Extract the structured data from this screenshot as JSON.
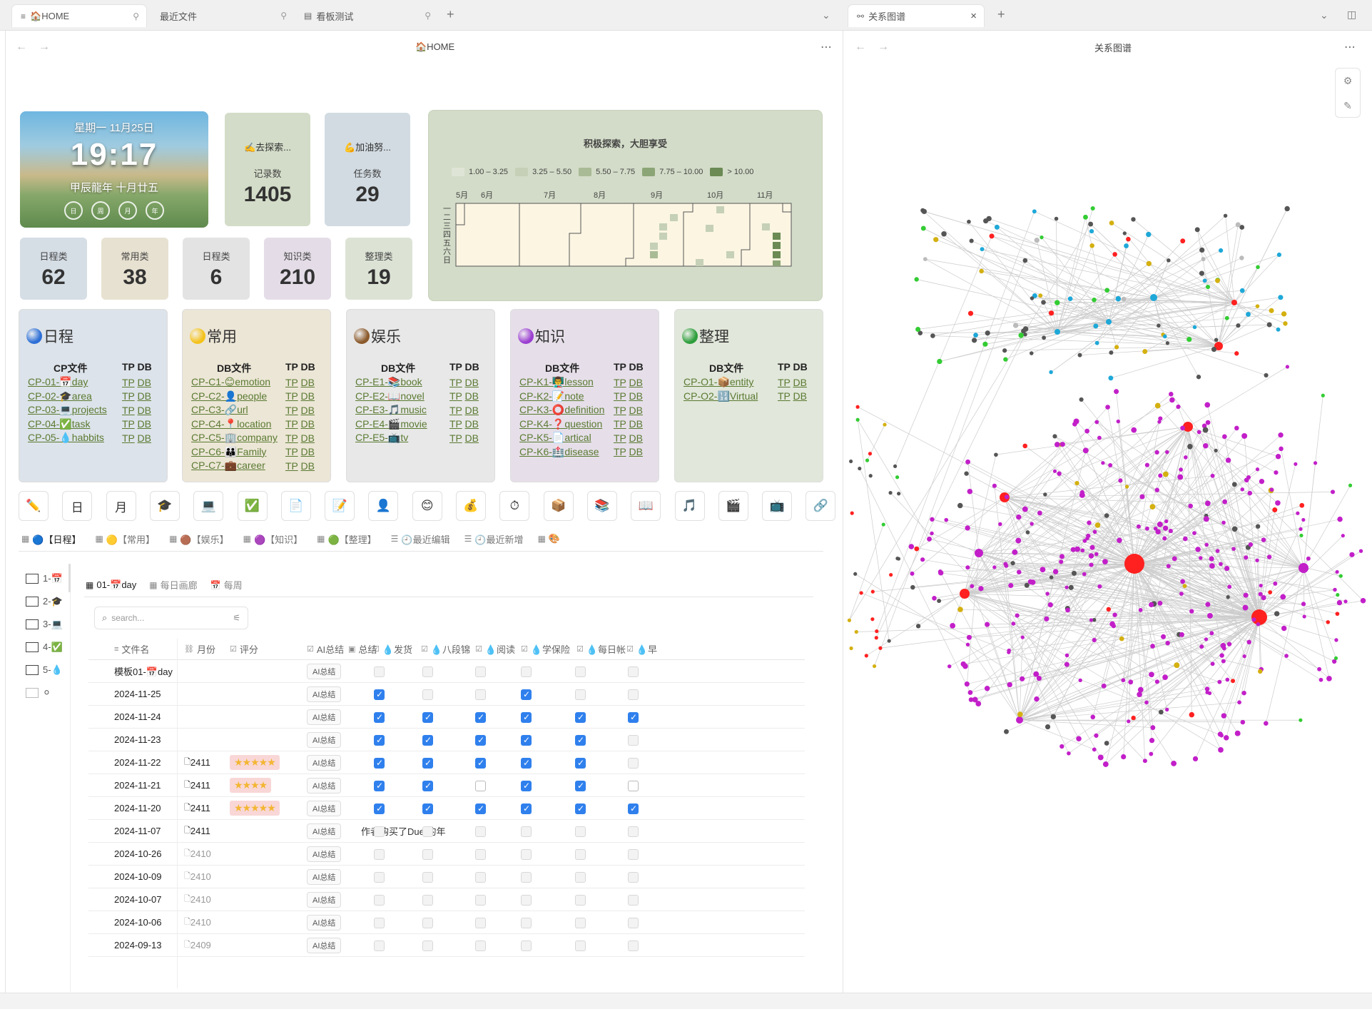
{
  "tabs": [
    {
      "label": "🏠HOME",
      "icon": "≡",
      "pin": "⚲"
    },
    {
      "label": "最近文件",
      "pin": "⚲"
    },
    {
      "label": "看板测试",
      "icon": "▤",
      "pin": "⚲"
    }
  ],
  "right_tab": {
    "label": "关系图谱",
    "icon": "⚯"
  },
  "left_pane_title": "🏠HOME",
  "right_pane_title": "关系图谱",
  "clock": {
    "date": "星期一 11月25日",
    "time": "19:17",
    "lunar": "甲辰龍年 十月廿五",
    "rings": [
      "日",
      "周",
      "月",
      "年"
    ]
  },
  "stat_cards": [
    {
      "title": "✍️去探索...",
      "label": "记录数",
      "value": "1405",
      "bg": "#d3dcc8"
    },
    {
      "title": "💪加油努...",
      "label": "任务数",
      "value": "29",
      "bg": "#d2dbe2"
    },
    {
      "label": "日程类",
      "value": "62",
      "bg": "#d5dde5"
    },
    {
      "label": "常用类",
      "value": "38",
      "bg": "#e7e1d1"
    },
    {
      "label": "日程类",
      "value": "6",
      "bg": "#e3e3e3"
    },
    {
      "label": "知识类",
      "value": "210",
      "bg": "#e4dde8"
    },
    {
      "label": "整理类",
      "value": "19",
      "bg": "#dce3d5"
    }
  ],
  "heatmap": {
    "title": "积极探索，大胆享受",
    "legend": [
      "1.00 – 3.25",
      "3.25 – 5.50",
      "5.50 – 7.75",
      "7.75 – 10.00",
      "> 10.00"
    ],
    "legend_colors": [
      "#dfe5d6",
      "#c5d0b7",
      "#a9bb95",
      "#8ca576",
      "#6b8a54"
    ],
    "months": [
      "5月",
      "6月",
      "7月",
      "8月",
      "9月",
      "10月",
      "11月"
    ],
    "weekdays": [
      "一",
      "二",
      "三",
      "四",
      "五",
      "六",
      "日"
    ]
  },
  "categories": [
    {
      "title": "日程",
      "dot": "#2d6fd6",
      "bg": "#dde3ea",
      "head": "CP文件",
      "rows": [
        [
          "CP-01-📅day"
        ],
        [
          "CP-02-🎓area"
        ],
        [
          "CP-03-💻projects"
        ],
        [
          "CP-04-✅task"
        ],
        [
          "CP-05-💧habbits"
        ]
      ]
    },
    {
      "title": "常用",
      "dot": "#f4c21b",
      "bg": "#ece6d6",
      "head": "DB文件",
      "rows": [
        [
          "CP-C1-😊emotion"
        ],
        [
          "CP-C2-👤people"
        ],
        [
          "CP-C3-🔗url"
        ],
        [
          "CP-C4-📍location"
        ],
        [
          "CP-C5-🏢company"
        ],
        [
          "CP-C6-👪Family"
        ],
        [
          "CP-C7-💼career"
        ]
      ]
    },
    {
      "title": "娱乐",
      "dot": "#8b5a2b",
      "bg": "#e8e8e8",
      "head": "DB文件",
      "rows": [
        [
          "CP-E1-📚book"
        ],
        [
          "CP-E2-📖novel"
        ],
        [
          "CP-E3-🎵music"
        ],
        [
          "CP-E4-🎬movie"
        ],
        [
          "CP-E5-📺tv"
        ]
      ]
    },
    {
      "title": "知识",
      "dot": "#9b3fd1",
      "bg": "#e6dfe9",
      "head": "DB文件",
      "rows": [
        [
          "CP-K1-👨‍🏫lesson"
        ],
        [
          "CP-K2-📝note"
        ],
        [
          "CP-K3-⭕definition"
        ],
        [
          "CP-K4-❓question"
        ],
        [
          "CP-K5-📄artical"
        ],
        [
          "CP-K6-🏥disease"
        ]
      ]
    },
    {
      "title": "整理",
      "dot": "#2e9e3c",
      "bg": "#e1e7da",
      "head": "DB文件",
      "rows": [
        [
          "CP-O1-📦entity"
        ],
        [
          "CP-O2-🔢Virtual"
        ]
      ]
    }
  ],
  "tp": "TP",
  "db": "DB",
  "tpdb_head": "TP DB",
  "icon_row": [
    "✏️",
    "日",
    "月",
    "🎓",
    "💻",
    "✅",
    "📄",
    "📝",
    "👤",
    "😊",
    "💰",
    "⏱",
    "📦",
    "📚",
    "📖",
    "🎵",
    "🎬",
    "📺",
    "🔗"
  ],
  "view_tabs": [
    {
      "label": "🔵【日程】",
      "active": true
    },
    {
      "label": "🟡【常用】"
    },
    {
      "label": "🟤【娱乐】"
    },
    {
      "label": "🟣【知识】"
    },
    {
      "label": "🟢【整理】"
    },
    {
      "label": "🕘最近编辑",
      "list": true
    },
    {
      "label": "🕘最近新增",
      "list": true
    },
    {
      "label": "🎨",
      "grid": true
    }
  ],
  "side_items": [
    "1-📅",
    "2-🎓",
    "3-💻",
    "4-✅",
    "5-💧",
    "⚪"
  ],
  "sub_tabs": [
    {
      "label": "01-📅day",
      "active": true,
      "icon": "▦"
    },
    {
      "label": "每日画廊",
      "icon": "▦"
    },
    {
      "label": "每周",
      "icon": "📅"
    }
  ],
  "search": {
    "placeholder": "search..."
  },
  "columns": {
    "name": "文件名",
    "month": "月份",
    "rating": "评分",
    "ai": "AI总结",
    "summary": "总结",
    "habits": [
      "💧发货",
      "💧八段锦",
      "💧阅读",
      "💧学保险",
      "💧每日帐",
      "💧早"
    ]
  },
  "ai_label": "AI总结",
  "rows": [
    {
      "name": "模板01-📅day",
      "month": "",
      "stars": 0,
      "summary": "",
      "checks": [
        0,
        0,
        0,
        0,
        0,
        0
      ]
    },
    {
      "name": "2024-11-25",
      "month": "",
      "stars": 0,
      "summary": "",
      "checks": [
        1,
        0,
        0,
        1,
        0,
        0
      ]
    },
    {
      "name": "2024-11-24",
      "month": "",
      "stars": 0,
      "summary": "",
      "checks": [
        1,
        1,
        1,
        1,
        1,
        1
      ]
    },
    {
      "name": "2024-11-23",
      "month": "",
      "stars": 0,
      "summary": "",
      "checks": [
        1,
        1,
        1,
        1,
        1,
        0
      ]
    },
    {
      "name": "2024-11-22",
      "month": "2411",
      "stars": 5,
      "summary": "",
      "checks": [
        1,
        1,
        1,
        1,
        1,
        0
      ]
    },
    {
      "name": "2024-11-21",
      "month": "2411",
      "stars": 4,
      "summary": "",
      "checks": [
        1,
        1,
        2,
        1,
        1,
        2
      ]
    },
    {
      "name": "2024-11-20",
      "month": "2411",
      "stars": 5,
      "summary": "",
      "checks": [
        1,
        1,
        1,
        1,
        1,
        1
      ]
    },
    {
      "name": "2024-11-07",
      "month": "2411",
      "stars": 0,
      "summary": "作者购买了Duet的年",
      "checks": [
        0,
        0,
        0,
        0,
        0,
        0
      ]
    },
    {
      "name": "2024-10-26",
      "month": "2410",
      "stars": 0,
      "summary": "",
      "checks": [
        0,
        0,
        0,
        0,
        0,
        0
      ],
      "old": true
    },
    {
      "name": "2024-10-09",
      "month": "2410",
      "stars": 0,
      "summary": "",
      "checks": [
        0,
        0,
        0,
        0,
        0,
        0
      ],
      "old": true
    },
    {
      "name": "2024-10-07",
      "month": "2410",
      "stars": 0,
      "summary": "",
      "checks": [
        0,
        0,
        0,
        0,
        0,
        0
      ],
      "old": true
    },
    {
      "name": "2024-10-06",
      "month": "2410",
      "stars": 0,
      "summary": "",
      "checks": [
        0,
        0,
        0,
        0,
        0,
        0
      ],
      "old": true
    },
    {
      "name": "2024-09-13",
      "month": "2409",
      "stars": 0,
      "summary": "",
      "checks": [
        0,
        0,
        0,
        0,
        0,
        0
      ],
      "old": true
    }
  ],
  "graph_colors": {
    "journal": "#c21fc9",
    "hub": "#ff2020",
    "gray": "#555555",
    "yellow": "#d4b010",
    "blue": "#1ea8d8",
    "green": "#33cc33",
    "edge": "#cccccc"
  }
}
